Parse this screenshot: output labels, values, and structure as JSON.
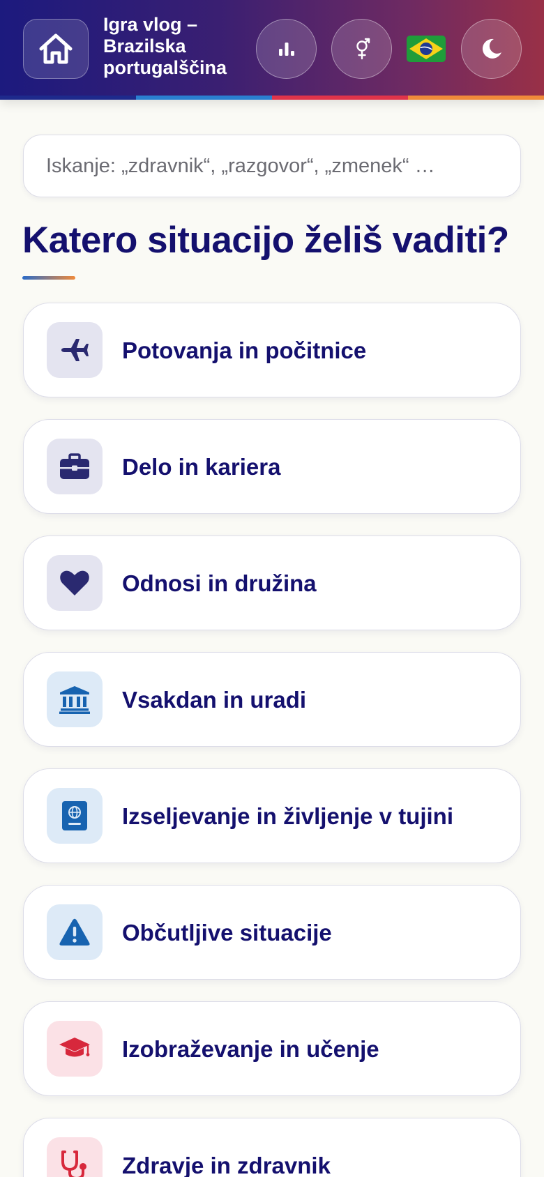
{
  "header": {
    "title": "Igra vlog – Brazilska portugalščina",
    "title_lines": [
      "Igra vlog –",
      "Brazilska",
      "portugalščina"
    ],
    "home_icon": "home-icon",
    "stats_icon": "bar-chart-icon",
    "gender_icon": "gender-icon",
    "flag_icon": "brazil-flag-icon",
    "theme_icon": "moon-icon",
    "stripe_colors": [
      "#1e2a8c",
      "#2a7fd0",
      "#e0344a",
      "#f08a3a"
    ]
  },
  "search": {
    "placeholder": "Iskanje: „zdravnik“, „razgovor“, „zmenek“ …"
  },
  "main": {
    "heading": "Katero situacijo želiš vaditi?"
  },
  "categories": [
    {
      "label": "Potovanja in počitnice",
      "icon": "airplane-icon",
      "icon_bg": "#e4e4f0",
      "icon_color": "#2a2970"
    },
    {
      "label": "Delo in kariera",
      "icon": "briefcase-icon",
      "icon_bg": "#e4e4f0",
      "icon_color": "#2a2970"
    },
    {
      "label": "Odnosi in družina",
      "icon": "heart-icon",
      "icon_bg": "#e4e4f0",
      "icon_color": "#2a2970"
    },
    {
      "label": "Vsakdan in uradi",
      "icon": "bank-icon",
      "icon_bg": "#ddeaf7",
      "icon_color": "#1763b0"
    },
    {
      "label": "Izseljevanje in življenje v tujini",
      "icon": "passport-icon",
      "icon_bg": "#ddeaf7",
      "icon_color": "#1763b0"
    },
    {
      "label": "Občutljive situacije",
      "icon": "warning-icon",
      "icon_bg": "#ddeaf7",
      "icon_color": "#1763b0"
    },
    {
      "label": "Izobraževanje in učenje",
      "icon": "graduation-cap-icon",
      "icon_bg": "#fbe1e6",
      "icon_color": "#d7283c"
    },
    {
      "label": "Zdravje in zdravnik",
      "icon": "stethoscope-icon",
      "icon_bg": "#fbe1e6",
      "icon_color": "#d7283c"
    }
  ]
}
